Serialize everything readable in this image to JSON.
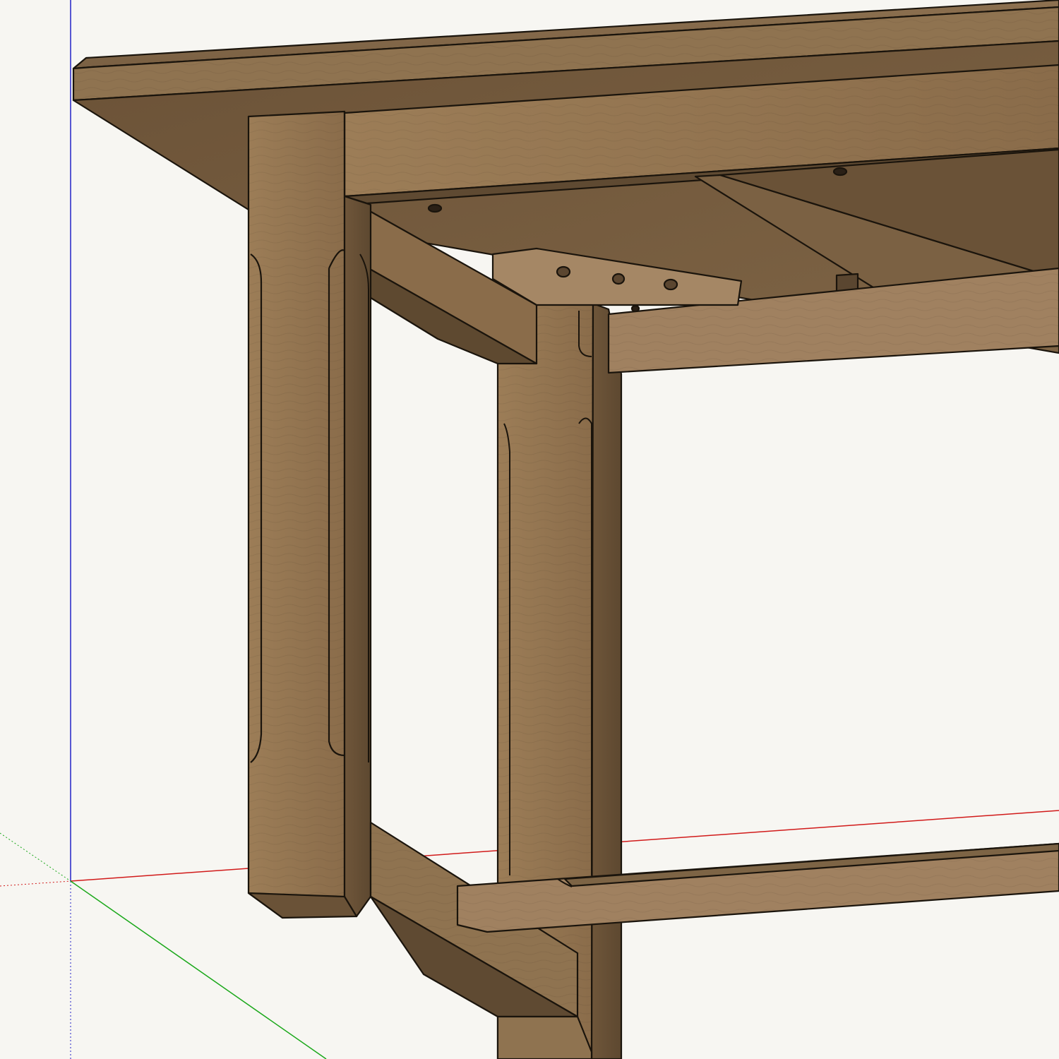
{
  "viewport": {
    "background": "#f7f6f2",
    "axis_colors": {
      "x": "#d11a1a",
      "y": "#1aa81a",
      "z": "#2323c8"
    }
  },
  "model": {
    "wood": {
      "light": "#a98a62",
      "mid": "#8f7350",
      "dark": "#6e5538",
      "edge": "#1a140c"
    },
    "parts": [
      "table-top",
      "apron-front",
      "apron-side",
      "corner-brace",
      "leg-front",
      "leg-back",
      "stretcher-side",
      "stretcher-long",
      "cross-rail"
    ]
  }
}
